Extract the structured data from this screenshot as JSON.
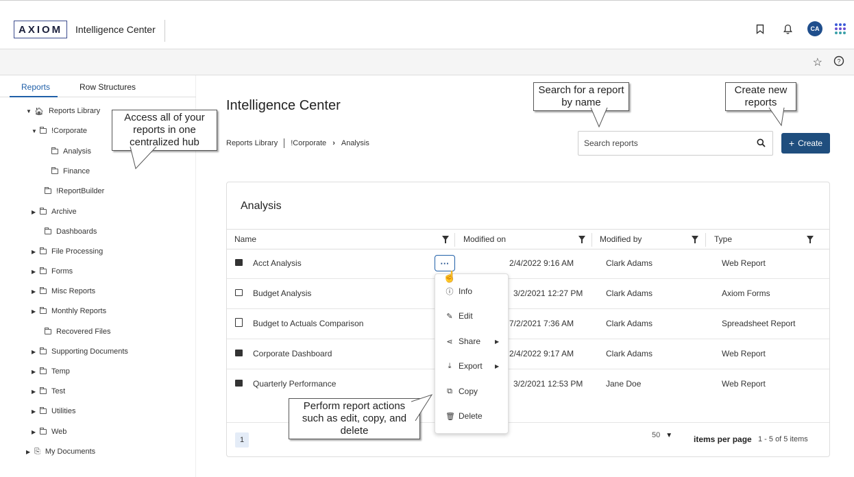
{
  "header": {
    "logo_text": "AXIOM",
    "app_title": "Intelligence Center",
    "avatar_initials": "CA",
    "icons": [
      "bookmark-icon",
      "bell-icon",
      "avatar",
      "apps-grid-icon"
    ],
    "grid_colors": [
      "#3c5bd8",
      "#6a4fd0",
      "#3aa0a8"
    ]
  },
  "subbar": {
    "icons": [
      "star-icon",
      "help-icon"
    ]
  },
  "sidebar": {
    "tabs": [
      "Reports",
      "Row Structures"
    ],
    "tree": [
      {
        "label": "Reports Library",
        "icon": "home-icon",
        "expanded": true
      },
      {
        "label": "!Corporate",
        "expanded": true
      },
      {
        "label": "Analysis"
      },
      {
        "label": "Finance"
      },
      {
        "label": "!ReportBuilder"
      },
      {
        "label": "Archive"
      },
      {
        "label": "Dashboards"
      },
      {
        "label": "File Processing"
      },
      {
        "label": "Forms"
      },
      {
        "label": "Misc Reports"
      },
      {
        "label": "Monthly Reports"
      },
      {
        "label": "Recovered Files"
      },
      {
        "label": "Supporting Documents"
      },
      {
        "label": "Temp"
      },
      {
        "label": "Test"
      },
      {
        "label": "Utilities"
      },
      {
        "label": "Web"
      },
      {
        "label": "My Documents",
        "icon": "documents-icon"
      }
    ]
  },
  "main": {
    "title": "Intelligence Center",
    "breadcrumb": [
      "Reports Library",
      "!Corporate",
      "Analysis"
    ],
    "search_placeholder": "Search reports",
    "create_label": "Create",
    "create_color": "#1f4e7e"
  },
  "table": {
    "title": "Analysis",
    "columns": [
      "Name",
      "Modified on",
      "Modified by",
      "Type"
    ],
    "rows": [
      {
        "name": "Acct Analysis",
        "modified_on": "2/4/2022 9:16 AM",
        "modified_by": "Clark Adams",
        "type": "Web Report"
      },
      {
        "name": "Budget Analysis",
        "modified_on": "3/2/2021 12:27 PM",
        "modified_by": "Clark Adams",
        "type": "Axiom Forms"
      },
      {
        "name": "Budget to Actuals Comparison",
        "modified_on": "7/2/2021 7:36 AM",
        "modified_by": "Clark Adams",
        "type": "Spreadsheet Report"
      },
      {
        "name": "Corporate Dashboard",
        "modified_on": "2/4/2022 9:17 AM",
        "modified_by": "Clark Adams",
        "type": "Web Report"
      },
      {
        "name": "Quarterly Performance",
        "modified_on": "3/2/2021 12:53 PM",
        "modified_by": "Jane Doe",
        "type": "Web Report"
      }
    ],
    "more_label": "···",
    "pager_page": "1",
    "page_size": "50",
    "items_per_page_label": "items per page",
    "item_count": "1 - 5 of 5 items"
  },
  "context_menu": {
    "items": [
      {
        "label": "Info",
        "icon": "info-icon"
      },
      {
        "label": "Edit",
        "icon": "pencil-icon"
      },
      {
        "label": "Share",
        "icon": "share-icon",
        "submenu": true
      },
      {
        "label": "Export",
        "icon": "export-icon",
        "submenu": true
      },
      {
        "label": "Copy",
        "icon": "copy-icon"
      },
      {
        "label": "Delete",
        "icon": "trash-icon"
      }
    ]
  },
  "callouts": {
    "sidebar": "Access all of your reports in one centralized hub",
    "search": "Search for a report by name",
    "create": "Create new reports",
    "actions": "Perform report actions such as edit, copy, and delete"
  }
}
